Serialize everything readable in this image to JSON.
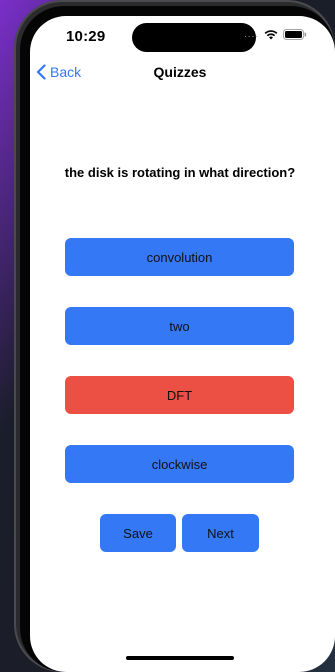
{
  "status_bar": {
    "time": "10:29",
    "signal_dots": "....",
    "icons": [
      "wifi-icon",
      "battery-icon"
    ]
  },
  "nav": {
    "back_label": "Back",
    "title": "Quizzes"
  },
  "question": "the disk is rotating in what direction?",
  "answers": [
    {
      "label": "convolution",
      "state": "default"
    },
    {
      "label": "two",
      "state": "default"
    },
    {
      "label": "DFT",
      "state": "wrong"
    },
    {
      "label": "clockwise",
      "state": "default"
    }
  ],
  "actions": {
    "save_label": "Save",
    "next_label": "Next"
  },
  "colors": {
    "accent": "#3478f6",
    "wrong": "#ec4f43"
  }
}
